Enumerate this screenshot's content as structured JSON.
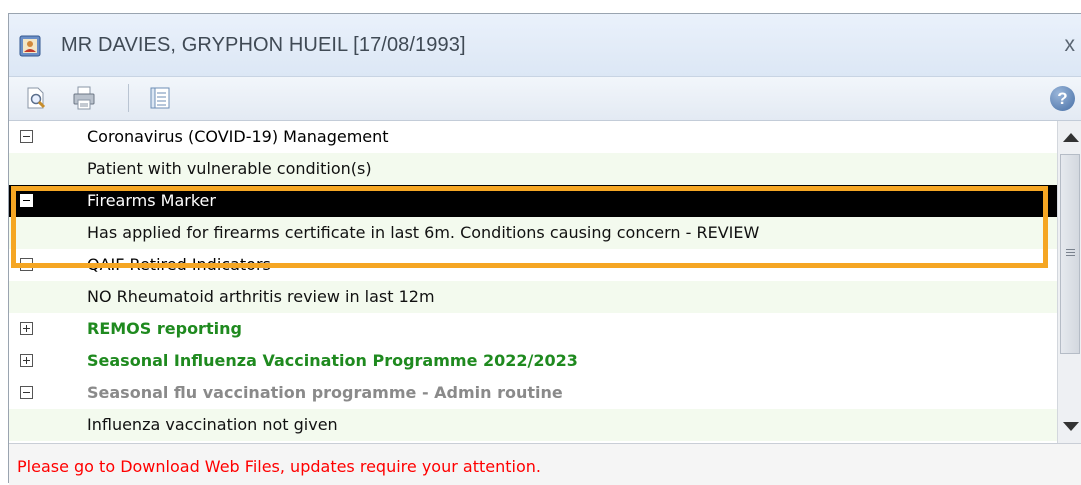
{
  "window": {
    "title": "MR DAVIES, GRYPHON HUEIL [17/08/1993]",
    "close_label": "x",
    "icon": "patient-card-icon"
  },
  "toolbar": {
    "buttons": [
      {
        "icon": "print-preview-icon"
      },
      {
        "icon": "printer-icon"
      },
      {
        "icon": "list-view-icon"
      }
    ],
    "help_label": "?"
  },
  "rows": [
    {
      "kind": "group",
      "expanded": true,
      "text": "Coronavirus (COVID-19) Management",
      "style": "normal"
    },
    {
      "kind": "detail",
      "text": "Patient with vulnerable condition(s)"
    },
    {
      "kind": "group",
      "expanded": true,
      "text": "Firearms Marker",
      "style": "selected"
    },
    {
      "kind": "detail",
      "text": "Has applied for firearms certificate in last 6m. Conditions causing concern - REVIEW"
    },
    {
      "kind": "group",
      "expanded": true,
      "text": "QAIF Retired Indicators",
      "style": "normal"
    },
    {
      "kind": "detail",
      "text": "NO Rheumatoid arthritis review in last 12m"
    },
    {
      "kind": "group",
      "expanded": false,
      "text": "REMOS reporting",
      "style": "bold-green"
    },
    {
      "kind": "group",
      "expanded": false,
      "text": "Seasonal Influenza Vaccination Programme 2022/2023",
      "style": "bold-green"
    },
    {
      "kind": "group",
      "expanded": true,
      "text": "Seasonal flu vaccination programme - Admin routine",
      "style": "bold-grey"
    },
    {
      "kind": "detail",
      "text": "Influenza vaccination not given"
    }
  ],
  "status": {
    "message": "Please go to Download Web Files, updates require your attention."
  },
  "colors": {
    "highlight": "#f5a623",
    "selected_bg": "#000000",
    "green_text": "#1f8a1f",
    "status_text": "#ff0000"
  }
}
